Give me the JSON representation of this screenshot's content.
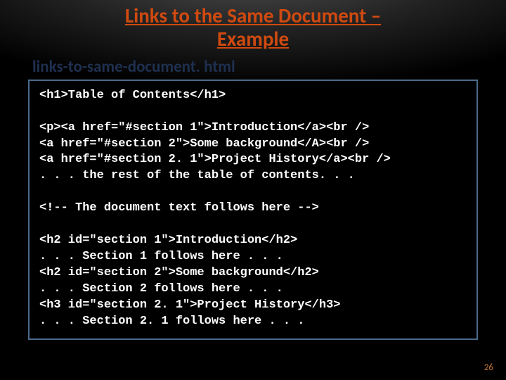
{
  "title_line1": "Links to the Same Document –",
  "title_line2": "Example",
  "subtitle": "links-to-same-document. html",
  "code": {
    "l1": "<h1>Table of Contents</h1>",
    "l2": "",
    "l3": "<p><a href=\"#section 1\">Introduction</a><br />",
    "l4": "<a href=\"#section 2\">Some background</A><br />",
    "l5": "<a href=\"#section 2. 1\">Project History</a><br />",
    "l6": ". . . the rest of the table of contents. . .",
    "l7": "",
    "l8": "<!-- The document text follows here -->",
    "l9": "",
    "l10": "<h2 id=\"section 1\">Introduction</h2>",
    "l11": ". . . Section 1 follows here . . .",
    "l12": "<h2 id=\"section 2\">Some background</h2>",
    "l13": ". . . Section 2 follows here . . .",
    "l14": "<h3 id=\"section 2. 1\">Project History</h3>",
    "l15": ". . . Section 2. 1 follows here . . ."
  },
  "page_number": "26"
}
